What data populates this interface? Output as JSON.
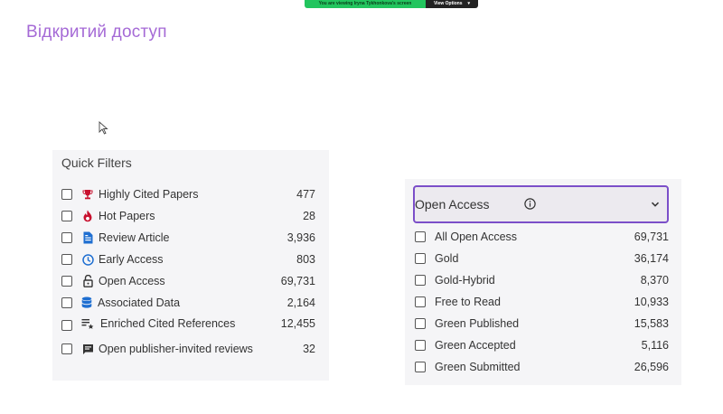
{
  "share_bar": {
    "message": "You are viewing Iryna Tykhonkova's screen",
    "options_label": "View Options",
    "options_icon": "chevron-down-icon"
  },
  "page_title": "Відкритий доступ",
  "quick_filters": {
    "title": "Quick Filters",
    "items": [
      {
        "label": "Highly Cited Papers",
        "count": "477",
        "icon": "trophy-icon"
      },
      {
        "label": "Hot Papers",
        "count": "28",
        "icon": "flame-icon"
      },
      {
        "label": "Review Article",
        "count": "3,936",
        "icon": "document-icon"
      },
      {
        "label": "Early Access",
        "count": "803",
        "icon": "clock-icon"
      },
      {
        "label": "Open Access",
        "count": "69,731",
        "icon": "unlock-icon"
      },
      {
        "label": "Associated Data",
        "count": "2,164",
        "icon": "database-icon"
      },
      {
        "label": "Enriched Cited References",
        "count": "12,455",
        "icon": "list-star-icon"
      },
      {
        "label": "Open publisher-invited reviews",
        "count": "32",
        "icon": "comment-icon"
      }
    ]
  },
  "open_access": {
    "title": "Open Access",
    "items": [
      {
        "label": "All Open Access",
        "count": "69,731"
      },
      {
        "label": "Gold",
        "count": "36,174"
      },
      {
        "label": "Gold-Hybrid",
        "count": "8,370"
      },
      {
        "label": "Free to Read",
        "count": "10,933"
      },
      {
        "label": "Green Published",
        "count": "15,583"
      },
      {
        "label": "Green Accepted",
        "count": "5,116"
      },
      {
        "label": "Green Submitted",
        "count": "26,596"
      }
    ]
  },
  "colors": {
    "title_purple": "#a56ad6",
    "accent_border": "#7b4fc9",
    "share_green": "#22c55e",
    "icon_blue": "#1f6fd1",
    "icon_red": "#c8102e",
    "icon_dark": "#333333"
  }
}
